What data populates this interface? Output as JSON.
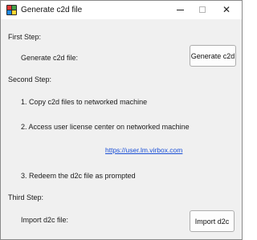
{
  "window": {
    "title": "Generate c2d file",
    "controls": {
      "minimize": "minimize",
      "maximize": "maximize",
      "close": "✕"
    }
  },
  "steps": {
    "first": {
      "heading": "First Step:",
      "row_label": "Generate c2d file:",
      "button_label": "Generate c2d"
    },
    "second": {
      "heading": "Second Step:",
      "item1": "1. Copy c2d files to networked machine",
      "item2": "2. Access user license center on networked machine",
      "link": "https://user.lm.virbox.com",
      "item3": "3. Redeem the d2c file as prompted"
    },
    "third": {
      "heading": "Third Step:",
      "row_label": "Import d2c file:",
      "button_label": "Import d2c"
    }
  },
  "icons": {
    "app": "app-icon",
    "minimize": "minimize-icon",
    "maximize": "maximize-icon",
    "close": "close-icon"
  }
}
